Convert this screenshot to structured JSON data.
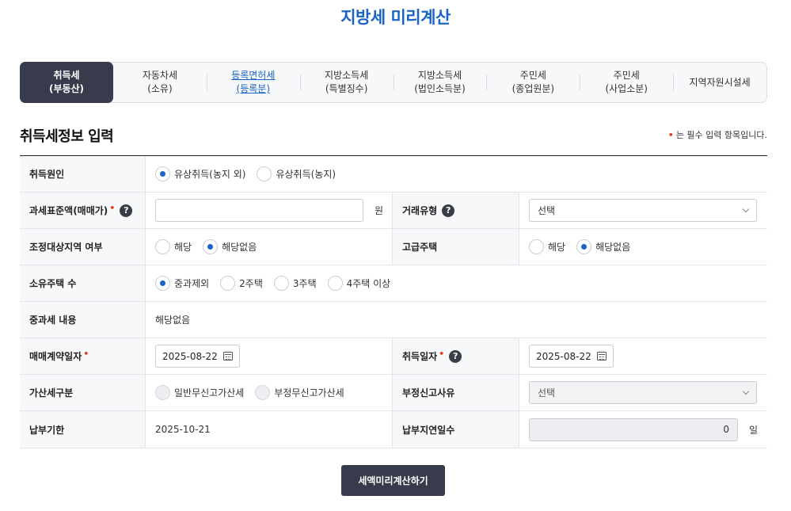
{
  "page_title": "지방세 미리계산",
  "tabs": [
    {
      "line1": "취득세",
      "line2": "(부동산)"
    },
    {
      "line1": "자동차세",
      "line2": "(소유)"
    },
    {
      "line1": "등록면허세",
      "line2": "(등록분)"
    },
    {
      "line1": "지방소득세",
      "line2": "(특별징수)"
    },
    {
      "line1": "지방소득세",
      "line2": "(법인소득분)"
    },
    {
      "line1": "주민세",
      "line2": "(종업원분)"
    },
    {
      "line1": "주민세",
      "line2": "(사업소분)"
    },
    {
      "line1": "지역자원시설세",
      "line2": ""
    }
  ],
  "section_title": "취득세정보 입력",
  "required_note": "는 필수 입력 항목입니다.",
  "required_mark": "•",
  "help_mark": "?",
  "form": {
    "acquisition_cause": {
      "label": "취득원인",
      "options": [
        "유상취득(농지 외)",
        "유상취득(농지)"
      ],
      "selected": "유상취득(농지 외)"
    },
    "tax_base": {
      "label": "과세표준액(매매가)",
      "value": "",
      "unit": "원"
    },
    "trade_type": {
      "label": "거래유형",
      "value": "선택"
    },
    "adjusted_area": {
      "label": "조정대상지역 여부",
      "options": [
        "해당",
        "해당없음"
      ],
      "selected": "해당없음"
    },
    "luxury_house": {
      "label": "고급주택",
      "options": [
        "해당",
        "해당없음"
      ],
      "selected": "해당없음"
    },
    "houses_owned": {
      "label": "소유주택 수",
      "options": [
        "중과제외",
        "2주택",
        "3주택",
        "4주택 이상"
      ],
      "selected": "중과제외"
    },
    "heavy_tax": {
      "label": "중과세 내용",
      "value": "해당없음"
    },
    "contract_date": {
      "label": "매매계약일자",
      "value": "2025-08-22"
    },
    "acquisition_date": {
      "label": "취득일자",
      "value": "2025-08-22"
    },
    "penalty_type": {
      "label": "가산세구분",
      "options": [
        "일반무신고가산세",
        "부정무신고가산세"
      ]
    },
    "fraud_reason": {
      "label": "부정신고사유",
      "value": "선택"
    },
    "due_date": {
      "label": "납부기한",
      "value": "2025-10-21"
    },
    "delay_days": {
      "label": "납부지연일수",
      "value": "0",
      "unit": "일"
    }
  },
  "calc_button": "세액미리계산하기"
}
